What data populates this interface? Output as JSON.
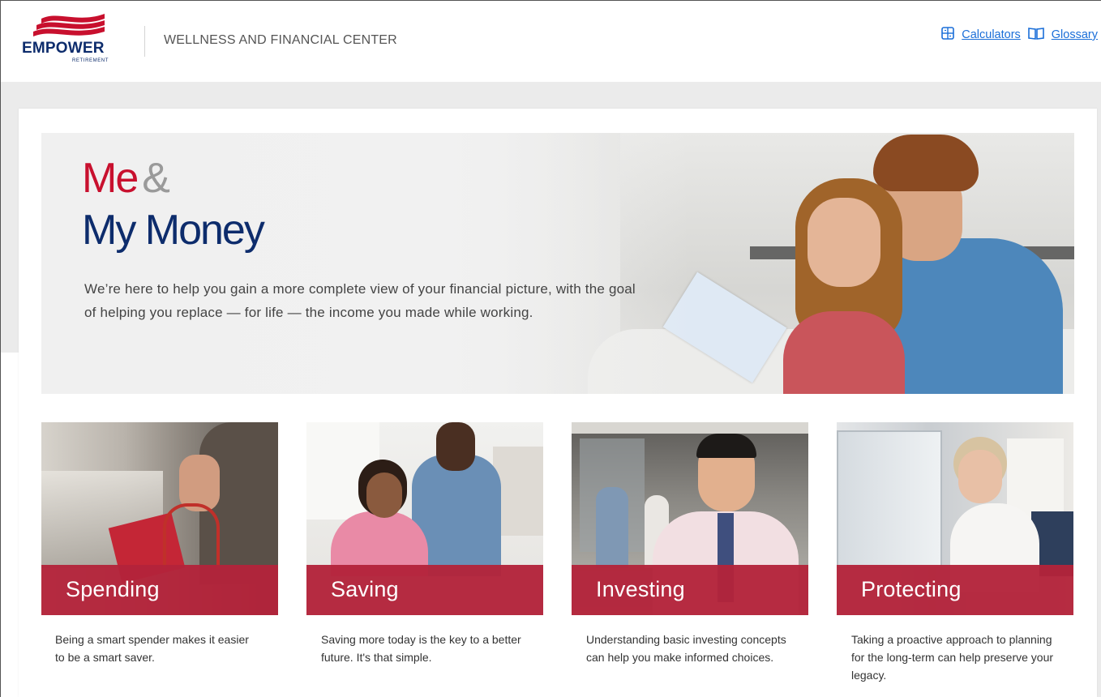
{
  "header": {
    "logo_text": "EMPOWER",
    "logo_subtext": "RETIREMENT",
    "site_title": "WELLNESS AND FINANCIAL CENTER",
    "links": [
      {
        "label": "Calculators",
        "icon": "calculator-icon"
      },
      {
        "label": "Glossary",
        "icon": "book-icon"
      }
    ]
  },
  "hero": {
    "title_line1": "Me",
    "title_amp": "&",
    "title_line2": "My Money",
    "description": "We’re here to help you gain a more complete view of your financial picture, with the goal of helping you replace — for life — the income you made while working."
  },
  "tiles": [
    {
      "label": "Spending",
      "description": "Being a smart spender makes it easier to be a smart saver."
    },
    {
      "label": "Saving",
      "description": "Saving more today is the key to a better future. It's that simple."
    },
    {
      "label": "Investing",
      "description": "Understanding basic investing concepts can help you make informed choices."
    },
    {
      "label": "Protecting",
      "description": "Taking a proactive approach to planning for the long-term can help preserve your legacy."
    }
  ],
  "colors": {
    "brand_red": "#c8102e",
    "brand_navy": "#0d2c6c",
    "tile_band": "#b3233a",
    "link_blue": "#1a6ed8"
  }
}
